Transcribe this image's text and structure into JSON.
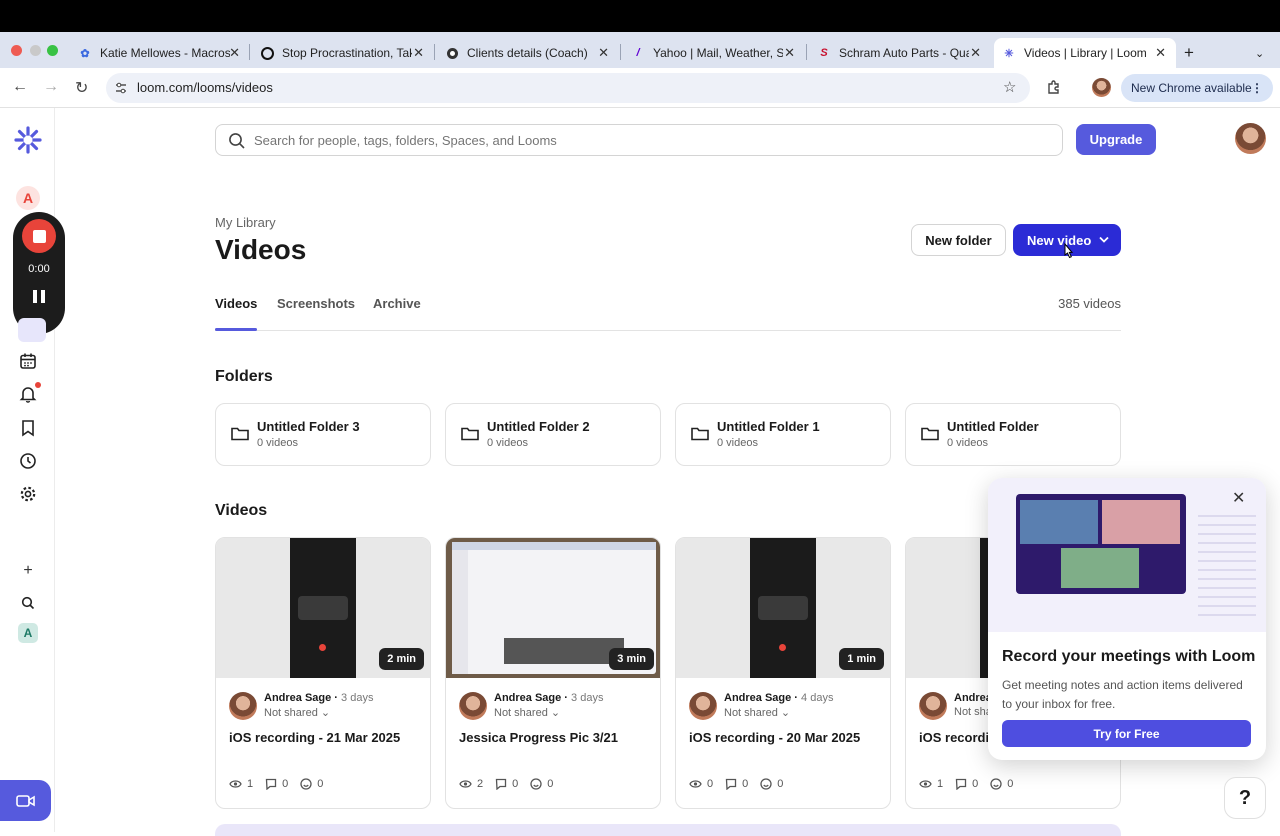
{
  "browser": {
    "tabs": [
      {
        "title": "Katie Mellowes - Macros",
        "favicon": "katie-favicon"
      },
      {
        "title": "Stop Procrastination, Tak",
        "favicon": "procrastination-favicon"
      },
      {
        "title": "Clients details (Coach)",
        "favicon": "clients-favicon"
      },
      {
        "title": "Yahoo | Mail, Weather, Se",
        "favicon": "yahoo-favicon"
      },
      {
        "title": "Schram Auto Parts - Qua",
        "favicon": "schram-favicon"
      },
      {
        "title": "Videos | Library | Loom",
        "favicon": "loom-favicon"
      }
    ],
    "url": "loom.com/looms/videos",
    "chrome_badge": "New Chrome available"
  },
  "recorder": {
    "timer": "0:00"
  },
  "search": {
    "placeholder": "Search for people, tags, folders, Spaces, and Looms"
  },
  "header": {
    "upgrade_label": "Upgrade"
  },
  "page": {
    "breadcrumb": "My Library",
    "title": "Videos",
    "new_folder_label": "New folder",
    "new_video_label": "New video",
    "tabs": [
      "Videos",
      "Screenshots",
      "Archive"
    ],
    "video_count": "385 videos"
  },
  "folders_section": {
    "title": "Folders",
    "items": [
      {
        "name": "Untitled Folder 3",
        "count": "0 videos"
      },
      {
        "name": "Untitled Folder 2",
        "count": "0 videos"
      },
      {
        "name": "Untitled Folder 1",
        "count": "0 videos"
      },
      {
        "name": "Untitled Folder",
        "count": "0 videos"
      }
    ]
  },
  "videos_section": {
    "title": "Videos",
    "items": [
      {
        "duration": "2 min",
        "author": "Andrea Sage",
        "age": "3 days",
        "sharing": "Not shared",
        "title": "iOS recording - 21 Mar 2025",
        "views": "1",
        "comments": "0",
        "reactions": "0"
      },
      {
        "duration": "3 min",
        "author": "Andrea Sage",
        "age": "3 days",
        "sharing": "Not shared",
        "title": "Jessica Progress Pic 3/21",
        "views": "2",
        "comments": "0",
        "reactions": "0"
      },
      {
        "duration": "1 min",
        "author": "Andrea Sage",
        "age": "4 days",
        "sharing": "Not shared",
        "title": "iOS recording - 20 Mar 2025",
        "views": "0",
        "comments": "0",
        "reactions": "0"
      },
      {
        "duration": "",
        "author": "Andrea Sage",
        "age": "",
        "sharing": "Not shared",
        "title": "iOS recording",
        "views": "1",
        "comments": "0",
        "reactions": "0"
      }
    ]
  },
  "promo": {
    "title": "Record your meetings with Loom",
    "body": "Get meeting notes and action items delivered to your inbox for free.",
    "button": "Try for Free"
  },
  "help": {
    "label": "?"
  },
  "colors": {
    "brand": "#565add",
    "primary_button": "#2b2bd6",
    "record": "#e8443a"
  }
}
